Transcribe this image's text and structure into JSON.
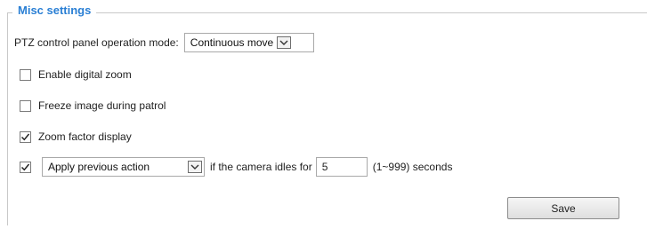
{
  "section": {
    "title": "Misc settings"
  },
  "ptz_mode": {
    "label": "PTZ control panel operation mode:",
    "selected": "Continuous move"
  },
  "options": [
    {
      "label": "Enable digital zoom",
      "checked": false
    },
    {
      "label": "Freeze image during patrol",
      "checked": false
    },
    {
      "label": "Zoom factor display",
      "checked": true
    }
  ],
  "idle": {
    "checked": true,
    "action_selected": "Apply previous action",
    "text_before": "if the camera idles for",
    "seconds_value": "5",
    "range_text": "(1~999) seconds"
  },
  "save_label": "Save"
}
